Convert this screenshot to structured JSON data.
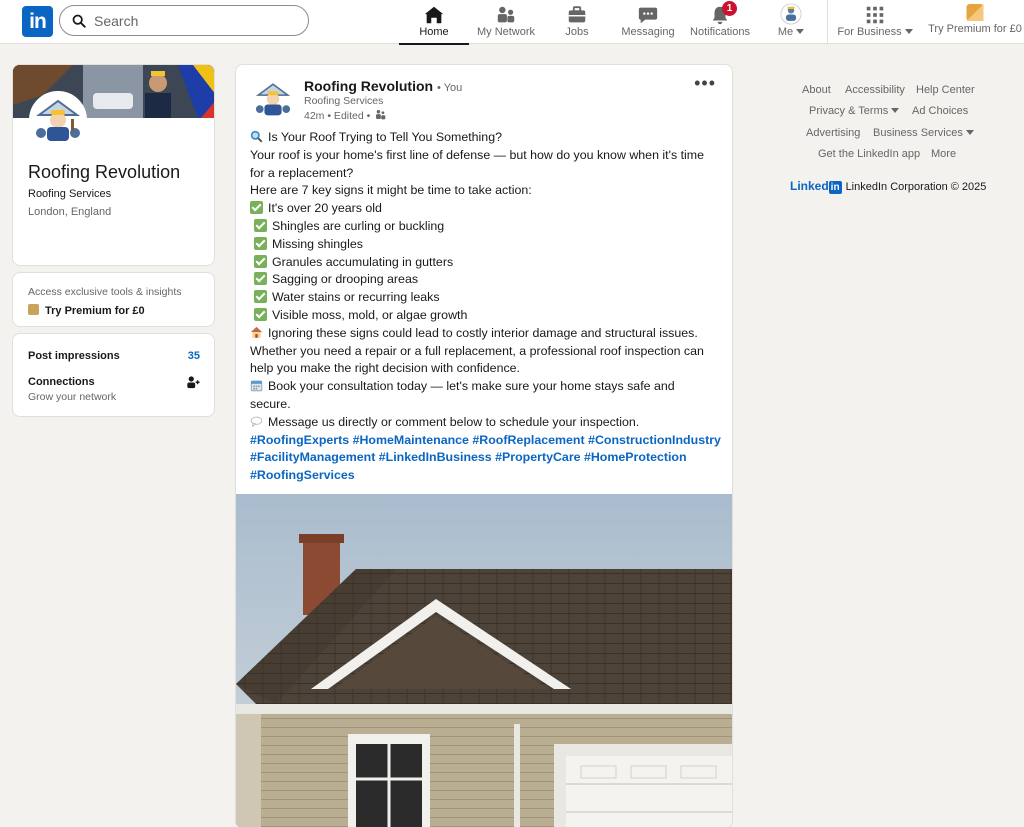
{
  "brand": {
    "logo_text": "in"
  },
  "search": {
    "placeholder": "Search"
  },
  "nav": {
    "items": [
      {
        "label": "Home",
        "icon": "home-icon",
        "active": true
      },
      {
        "label": "My Network",
        "icon": "network-icon"
      },
      {
        "label": "Jobs",
        "icon": "jobs-icon"
      },
      {
        "label": "Messaging",
        "icon": "messaging-icon"
      },
      {
        "label": "Notifications",
        "icon": "bell-icon",
        "badge": "1"
      },
      {
        "label": "Me",
        "icon": "avatar"
      },
      {
        "label": "For Business",
        "icon": "grid-icon"
      },
      {
        "label": "Try Premium for £0",
        "icon": "premium-icon"
      }
    ]
  },
  "profile": {
    "name": "Roofing Revolution",
    "headline": "Roofing Services",
    "location": "London, England"
  },
  "premium_card": {
    "text": "Access exclusive tools & insights",
    "cta": "Try Premium for £0"
  },
  "stats": {
    "impressions_label": "Post impressions",
    "impressions_value": "35",
    "connections_label": "Connections",
    "connections_sub": "Grow your network"
  },
  "post": {
    "author": "Roofing Revolution",
    "you": "• You",
    "subtitle": "Roofing Services",
    "meta": "42m • Edited •",
    "lines": [
      "Is Your Roof Trying to Tell You Something?",
      "Your roof is your home's first line of defense — but how do you know when it's time",
      "for a replacement?",
      "Here are 7 key signs it might be time to take action:"
    ],
    "signs": [
      "It's over 20 years old",
      "Shingles are curling or buckling",
      "Missing shingles",
      "Granules accumulating in gutters",
      "Sagging or drooping areas",
      "Water stains or recurring leaks",
      "Visible moss, mold, or algae growth"
    ],
    "closing": [
      "Ignoring these signs could lead to costly interior damage and structural issues.",
      "Whether you need a repair or a full replacement, a professional roof inspection can",
      "help you make the right decision with confidence.",
      "Book your consultation today — let's make sure your home stays safe and",
      "secure.",
      "Message us directly or comment below to schedule your inspection."
    ],
    "hashtags": [
      "#RoofingExperts #HomeMaintenance #RoofReplacement #ConstructionIndustry",
      "#FacilityManagement #LinkedInBusiness #PropertyCare #HomeProtection",
      "#RoofingServices"
    ]
  },
  "footer": {
    "links": [
      "About",
      "Accessibility",
      "Help Center",
      "Privacy & Terms",
      "Ad Choices",
      "Advertising",
      "Business Services",
      "Get the LinkedIn app",
      "More"
    ],
    "brand_word": "Linked",
    "brand_box": "in",
    "copyright": "LinkedIn Corporation © 2025"
  },
  "colors": {
    "accent": "#0a66c2",
    "badge": "#cb112d",
    "check": "#78b159",
    "page_bg": "#f4f2ee"
  }
}
